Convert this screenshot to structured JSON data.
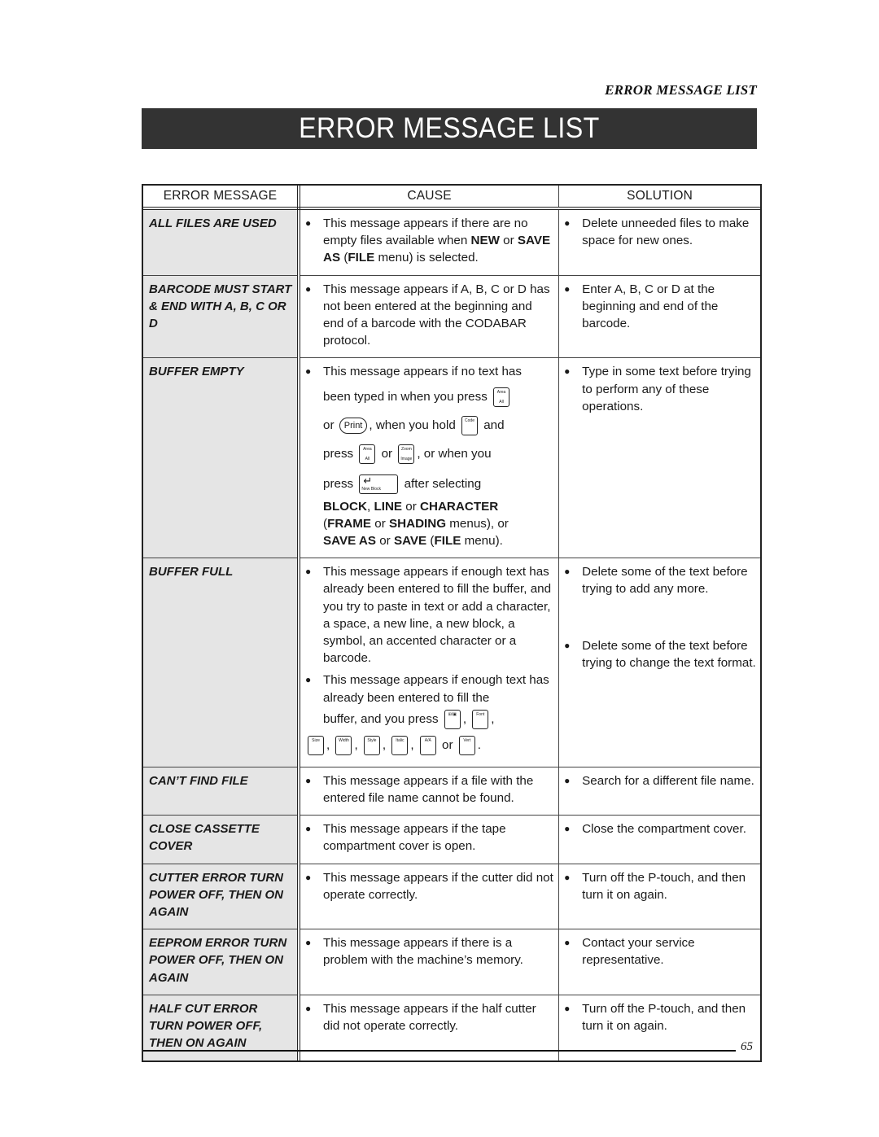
{
  "running_head": "ERROR MESSAGE LIST",
  "title": "ERROR MESSAGE LIST",
  "table": {
    "headers": [
      "ERROR MESSAGE",
      "CAUSE",
      "SOLUTION"
    ],
    "rows": [
      {
        "error": "ALL FILES ARE USED",
        "cause_parts": [
          "This message appears if there are no empty files available when ",
          "NEW",
          " or ",
          "SAVE AS",
          " (",
          "FILE",
          " menu) is selected."
        ],
        "solution": "Delete unneeded files to make space for new ones."
      },
      {
        "error": "BARCODE MUST START & END WITH A, B, C OR D",
        "cause": "This message appears if A, B, C or D has not been entered at the beginning and end of a barcode with the CODABAR protocol.",
        "solution": "Enter A, B, C or D at the beginning and end of the barcode."
      },
      {
        "error": "BUFFER EMPTY",
        "cause": {
          "l1": "This message appears if no text has",
          "l2": "been typed in when you press",
          "key_area_all": {
            "top": "Area",
            "bottom": "All"
          },
          "l3a": "or",
          "key_print": "Print",
          "l3b": ", when you hold",
          "key_code": "Code",
          "l3c": "and",
          "l4a": "press",
          "l4b": "or",
          "key_zoom_image": {
            "top": "Zoom",
            "bottom": "Image"
          },
          "l4c": ", or when you",
          "l5a": "press",
          "key_new_block": "New Block",
          "l5b": "after selecting",
          "l6": [
            "BLOCK",
            ", ",
            "LINE",
            " or ",
            "CHARACTER"
          ],
          "l7": [
            "(",
            "FRAME",
            " or ",
            "SHADING",
            " menus), or"
          ],
          "l8": [
            "SAVE AS",
            " or ",
            "SAVE",
            " (",
            "FILE",
            " menu)."
          ]
        },
        "solution": "Type in some text before trying to perform any of these operations."
      },
      {
        "error": "BUFFER FULL",
        "cause": "This message appears if enough text has already been entered to fill the buffer, and you try to paste in text or add a character, a space, a new line, a new block, a symbol, an accented character or a barcode.",
        "solution": "Delete some of the text before trying to add any more.",
        "cause2": {
          "l1": "This message appears if enough text has already been entered to fill the",
          "l2": "buffer, and you press",
          "keys": [
            "⊞/▣",
            "Font",
            "Size",
            "Width",
            "Style",
            "Italic",
            "A/A",
            "Vert"
          ],
          "or": "or"
        },
        "solution2": "Delete some of the text before trying to change the text format."
      },
      {
        "error": "CAN’T FIND FILE",
        "cause": "This message appears if a file with the entered file name cannot be found.",
        "solution": "Search for a different file name."
      },
      {
        "error": "CLOSE CASSETTE COVER",
        "cause": "This message appears if the tape compartment cover is open.",
        "solution": "Close the compartment cover."
      },
      {
        "error": "CUTTER ERROR TURN POWER OFF, THEN ON AGAIN",
        "cause": "This message appears if the cutter did not operate correctly.",
        "solution": "Turn off the P-touch, and then turn it on again."
      },
      {
        "error": "EEPROM ERROR TURN POWER OFF, THEN ON AGAIN",
        "cause": "This message appears if there is a problem with the machine’s memory.",
        "solution": "Contact your service representative."
      },
      {
        "error": "HALF CUT ERROR TURN POWER OFF, THEN ON AGAIN",
        "cause": "This message appears if the half cutter did not operate correctly.",
        "solution": "Turn off the P-touch, and then turn it on again."
      }
    ]
  },
  "footer": {
    "page_number": "65"
  },
  "colors": {
    "title_band": "#333333",
    "error_column_bg": "#e5e5e5"
  }
}
